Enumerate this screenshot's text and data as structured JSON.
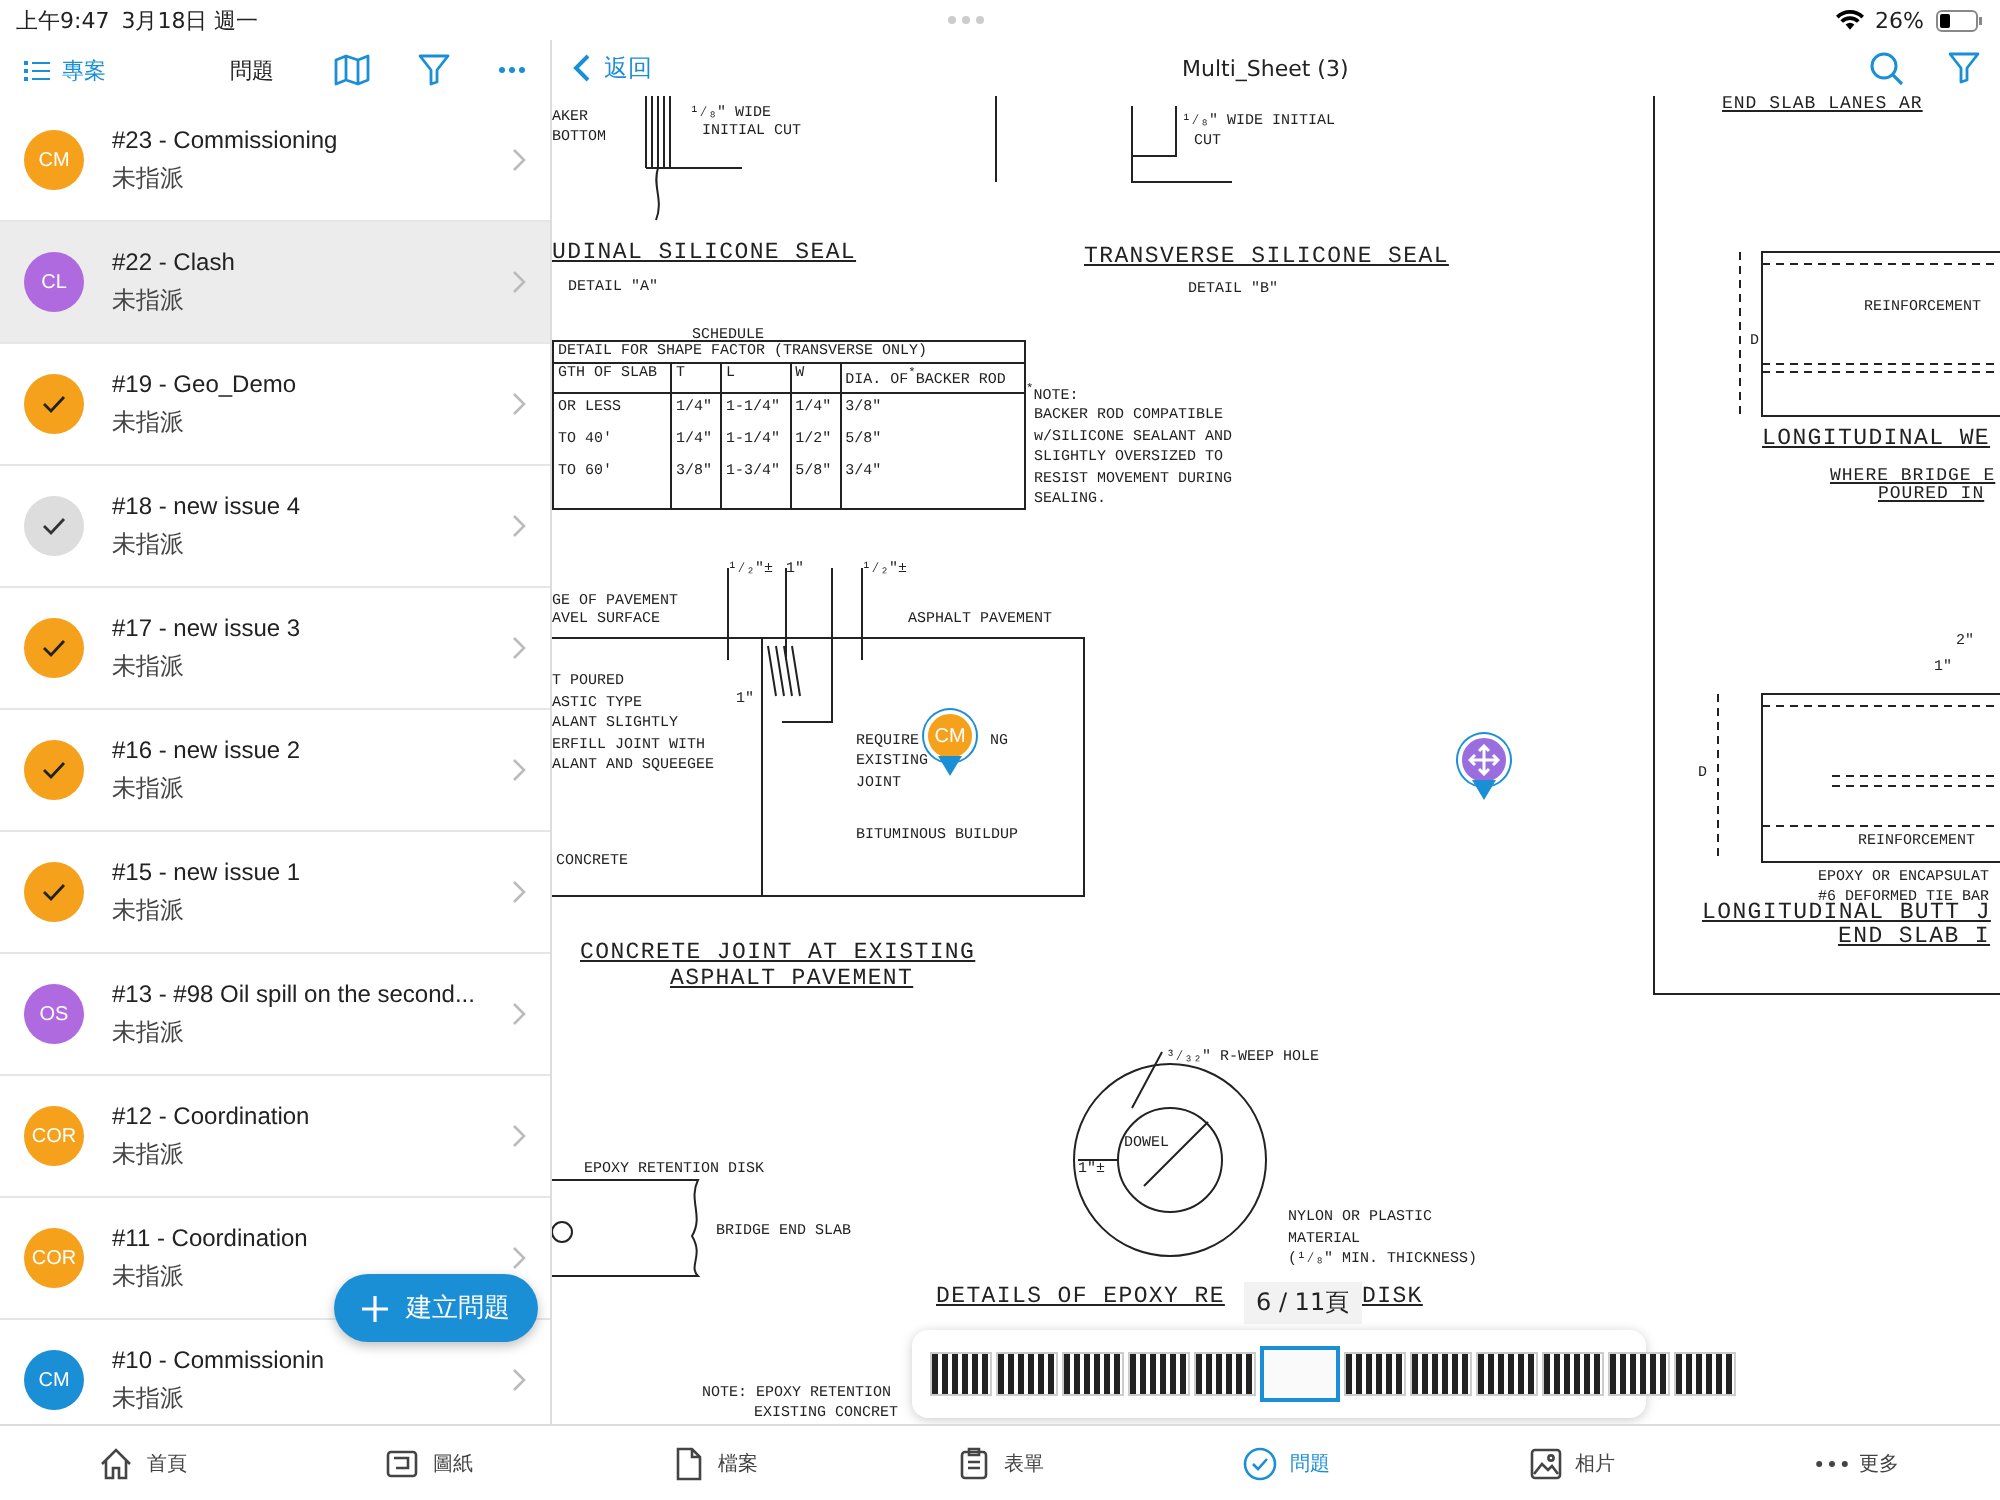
{
  "status_bar": {
    "time": "上午9:47",
    "date": "3月18日 週一",
    "battery": "26%"
  },
  "sidebar": {
    "project_label": "專案",
    "title": "問題",
    "issues": [
      {
        "title": "#23 - Commissioning",
        "status": "未指派",
        "avatar": {
          "kind": "initials",
          "text": "CM",
          "color": "#f5a11c"
        },
        "selected": false
      },
      {
        "title": "#22 - Clash",
        "status": "未指派",
        "avatar": {
          "kind": "initials",
          "text": "CL",
          "color": "#b06ae0"
        },
        "selected": true
      },
      {
        "title": "#19 - Geo_Demo",
        "status": "未指派",
        "avatar": {
          "kind": "check",
          "color": "#f5a11c"
        },
        "selected": false
      },
      {
        "title": "#18 - new issue 4",
        "status": "未指派",
        "avatar": {
          "kind": "check",
          "color": "#dddddd"
        },
        "selected": false
      },
      {
        "title": "#17 - new issue 3",
        "status": "未指派",
        "avatar": {
          "kind": "check",
          "color": "#f5a11c"
        },
        "selected": false
      },
      {
        "title": "#16 - new issue 2",
        "status": "未指派",
        "avatar": {
          "kind": "check",
          "color": "#f5a11c"
        },
        "selected": false
      },
      {
        "title": "#15 - new issue 1",
        "status": "未指派",
        "avatar": {
          "kind": "check",
          "color": "#f5a11c"
        },
        "selected": false
      },
      {
        "title": "#13 - #98 Oil spill on the second...",
        "status": "未指派",
        "avatar": {
          "kind": "initials",
          "text": "OS",
          "color": "#b06ae0"
        },
        "selected": false
      },
      {
        "title": "#12 - Coordination",
        "status": "未指派",
        "avatar": {
          "kind": "initials",
          "text": "COR",
          "color": "#f5a11c"
        },
        "selected": false
      },
      {
        "title": "#11 - Coordination",
        "status": "未指派",
        "avatar": {
          "kind": "initials",
          "text": "COR",
          "color": "#f5a11c"
        },
        "selected": false
      },
      {
        "title": "#10 - Commissionin",
        "status": "未指派",
        "avatar": {
          "kind": "initials",
          "text": "CM",
          "color": "#1a8fd6"
        },
        "selected": false
      }
    ],
    "create_button": "建立問題"
  },
  "viewer": {
    "back": "返回",
    "title": "Multi_Sheet (3)",
    "labels": [
      {
        "kind": "note",
        "text": "AKER"
      },
      {
        "kind": "note",
        "text": "BOTTOM"
      },
      {
        "kind": "note",
        "text": "¹⁄₈\" WIDE"
      },
      {
        "kind": "note",
        "text": "INITIAL CUT"
      },
      {
        "kind": "note",
        "text": "¹⁄₈\" WIDE INITIAL"
      },
      {
        "kind": "note",
        "text": "CUT"
      },
      {
        "kind": "title",
        "text": "UDINAL SILICONE SEAL"
      },
      {
        "kind": "note",
        "text": "DETAIL \"A\""
      },
      {
        "kind": "title",
        "text": "TRANSVERSE SILICONE SEAL"
      },
      {
        "kind": "note",
        "text": "DETAIL \"B\""
      },
      {
        "kind": "note",
        "text": "SCHEDULE"
      },
      {
        "kind": "note",
        "text": "$^{*}$NOTE:"
      },
      {
        "kind": "note",
        "text": "BACKER ROD COMPATIBLE\nw/SILICONE SEALANT AND\nSLIGHTLY OVERSIZED TO\nRESIST MOVEMENT DURING\nSEALING."
      },
      {
        "kind": "note",
        "text": "¹⁄₂\"±"
      },
      {
        "kind": "note",
        "text": "1\""
      },
      {
        "kind": "note",
        "text": "¹⁄₂\"±"
      },
      {
        "kind": "note",
        "text": "GE OF PAVEMENT"
      },
      {
        "kind": "note",
        "text": "AVEL SURFACE"
      },
      {
        "kind": "note",
        "text": "ASPHALT PAVEMENT"
      },
      {
        "kind": "note",
        "text": "T POURED\nASTIC TYPE\nALANT SLIGHTLY\nERFILL JOINT WITH\nALANT AND SQUEEGEE"
      },
      {
        "kind": "note",
        "text": "1\""
      },
      {
        "kind": "note",
        "text": "REQUIRE"
      },
      {
        "kind": "note",
        "text": "NG"
      },
      {
        "kind": "note",
        "text": "EXISTING\nJOINT"
      },
      {
        "kind": "note",
        "text": "BITUMINOUS BUILDUP"
      },
      {
        "kind": "note",
        "text": "CONCRETE"
      },
      {
        "kind": "title",
        "text": "CONCRETE JOINT AT EXISTING"
      },
      {
        "kind": "title",
        "text": "ASPHALT PAVEMENT"
      },
      {
        "kind": "subtitle",
        "text": "END SLAB LANES AR"
      },
      {
        "kind": "note",
        "text": "REINFORCEMENT"
      },
      {
        "kind": "note",
        "text": "D"
      },
      {
        "kind": "title",
        "text": "LONGITUDINAL WE"
      },
      {
        "kind": "subtitle",
        "text": "WHERE BRIDGE E"
      },
      {
        "kind": "subtitle",
        "text": "POURED IN"
      },
      {
        "kind": "note",
        "text": "2\""
      },
      {
        "kind": "note",
        "text": "1\""
      },
      {
        "kind": "note",
        "text": "D"
      },
      {
        "kind": "note",
        "text": "REINFORCEMENT"
      },
      {
        "kind": "note",
        "text": "EPOXY OR ENCAPSULAT"
      },
      {
        "kind": "note",
        "text": "#6 DEFORMED TIE BAR"
      },
      {
        "kind": "title",
        "text": "LONGITUDINAL BUTT J"
      },
      {
        "kind": "title",
        "text": "END SLAB I"
      },
      {
        "kind": "note",
        "text": "³⁄₃₂\" R-WEEP HOLE"
      },
      {
        "kind": "note",
        "text": "DOWEL"
      },
      {
        "kind": "note",
        "text": "1\"±"
      },
      {
        "kind": "note",
        "text": "NYLON OR PLASTIC\nMATERIAL\n(¹⁄₈\" MIN. THICKNESS)"
      },
      {
        "kind": "note",
        "text": "EPOXY RETENTION DISK"
      },
      {
        "kind": "note",
        "text": "BRIDGE END SLAB"
      },
      {
        "kind": "title",
        "text": "DETAILS OF EPOXY RE"
      },
      {
        "kind": "title",
        "text": "DISK"
      },
      {
        "kind": "note",
        "text": "NOTE: EPOXY RETENTION"
      },
      {
        "kind": "note",
        "text": "EXISTING CONCRET"
      }
    ],
    "schedule": {
      "caption": "DETAIL FOR SHAPE FACTOR (TRANSVERSE ONLY)",
      "columns": [
        "GTH OF SLAB",
        "T",
        "L",
        "W",
        "DIA. OF$^{*}$BACKER ROD"
      ],
      "rows": [
        [
          "OR LESS",
          "1/4\"",
          "1-1/4\"",
          "1/4\"",
          "3/8\""
        ],
        [
          "TO 40'",
          "1/4\"",
          "1-1/4\"",
          "1/2\"",
          "5/8\""
        ],
        [
          "TO 60'",
          "3/8\"",
          "1-3/4\"",
          "5/8\"",
          "3/4\""
        ]
      ]
    },
    "pins": [
      {
        "kind": "initials",
        "text": "CM",
        "color": "#f5a11c"
      },
      {
        "kind": "move",
        "color": "#9b6ee0"
      }
    ],
    "page_indicator": "6 / 11頁",
    "thumbnails": [
      {
        "selected": false
      },
      {
        "selected": false
      },
      {
        "selected": false
      },
      {
        "selected": false
      },
      {
        "selected": false
      },
      {
        "selected": true
      },
      {
        "selected": false
      },
      {
        "selected": false
      },
      {
        "selected": false
      },
      {
        "selected": false
      },
      {
        "selected": false
      },
      {
        "selected": false
      }
    ]
  },
  "tab_bar": [
    {
      "label": "首頁",
      "selected": false
    },
    {
      "label": "圖紙",
      "selected": false
    },
    {
      "label": "檔案",
      "selected": false
    },
    {
      "label": "表單",
      "selected": false
    },
    {
      "label": "問題",
      "selected": true
    },
    {
      "label": "相片",
      "selected": false
    },
    {
      "label": "更多",
      "selected": false
    }
  ]
}
